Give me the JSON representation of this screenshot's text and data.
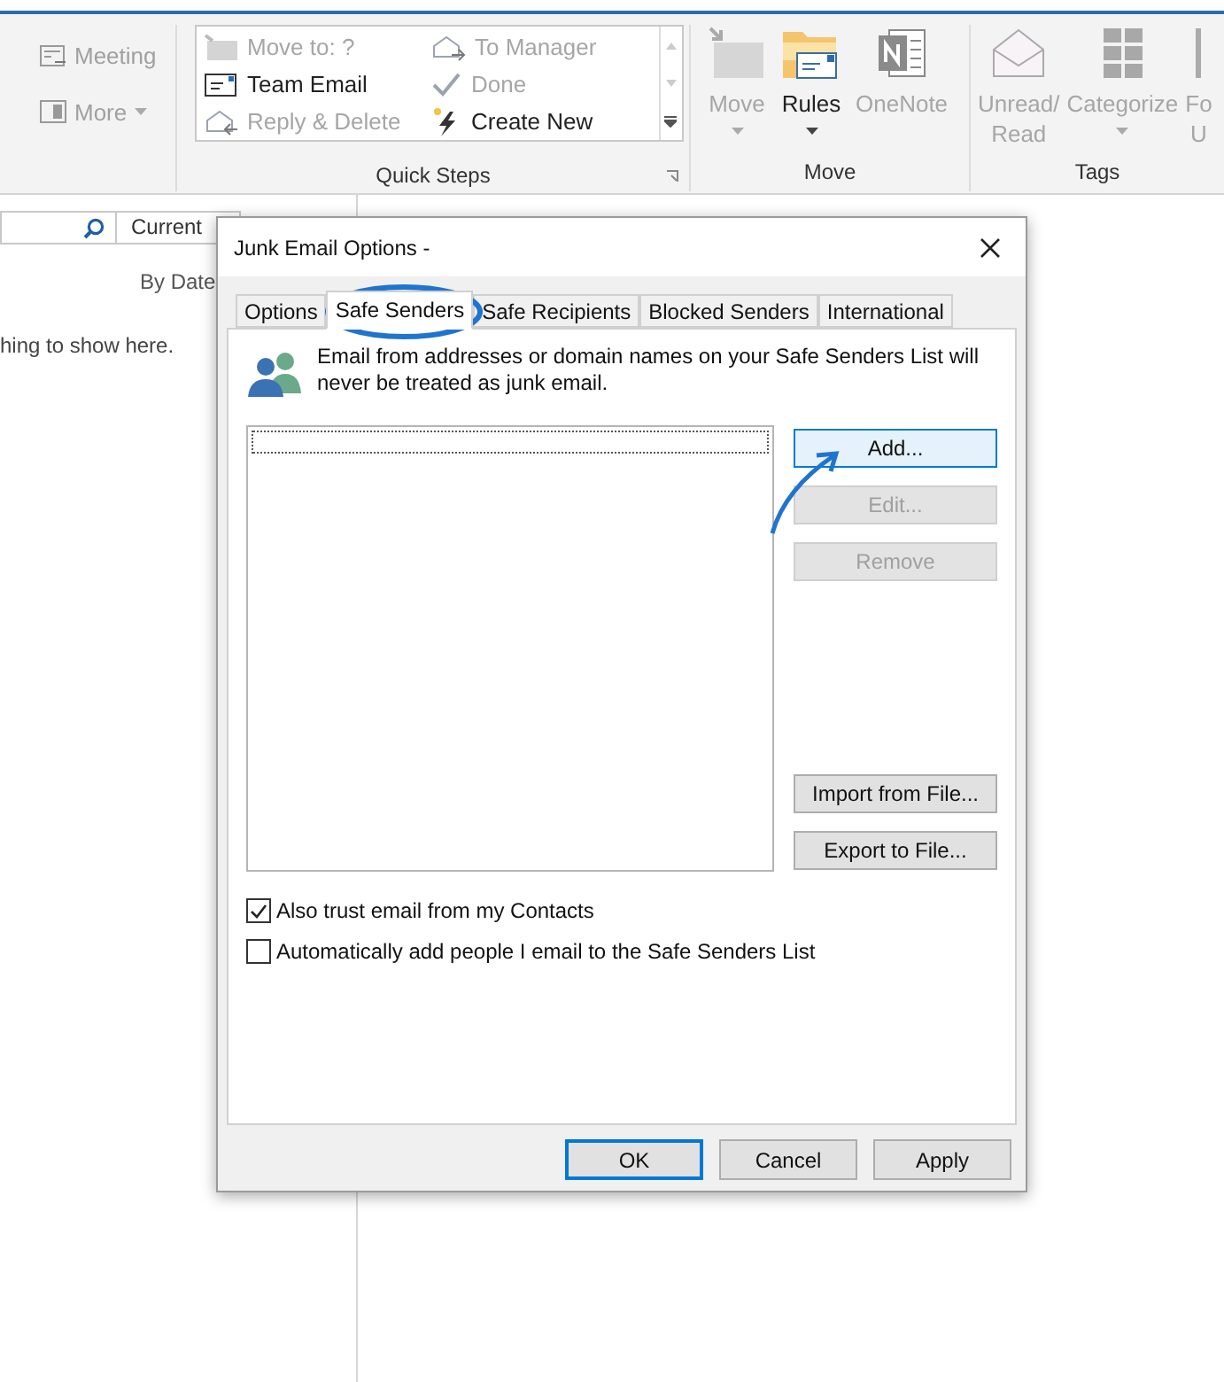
{
  "ribbon": {
    "left_items": [
      {
        "label": "Meeting",
        "disabled": true,
        "dropdown": false
      },
      {
        "label": "More",
        "disabled": true,
        "dropdown": true
      }
    ],
    "quick_steps": {
      "label": "Quick Steps",
      "items": [
        {
          "label": "Move to: ?",
          "disabled": true
        },
        {
          "label": "To Manager",
          "disabled": true
        },
        {
          "label": "Team Email",
          "disabled": false
        },
        {
          "label": "Done",
          "disabled": true
        },
        {
          "label": "Reply & Delete",
          "disabled": true
        },
        {
          "label": "Create New",
          "disabled": false
        }
      ]
    },
    "groups": [
      {
        "label": "Move",
        "buttons": [
          {
            "lines": [
              "Move"
            ],
            "disabled": true,
            "dropdown": true
          },
          {
            "lines": [
              "Rules"
            ],
            "disabled": false,
            "dropdown": true
          },
          {
            "lines": [
              "OneNote"
            ],
            "disabled": true,
            "dropdown": false
          }
        ]
      },
      {
        "label": "Tags",
        "buttons": [
          {
            "lines": [
              "Unread/",
              "Read"
            ],
            "disabled": true,
            "dropdown": false
          },
          {
            "lines": [
              "Categorize"
            ],
            "disabled": true,
            "dropdown": true
          },
          {
            "lines": [
              "Fo",
              "U"
            ],
            "disabled": true,
            "dropdown": false
          }
        ]
      }
    ]
  },
  "pane": {
    "filter": "Current",
    "sort": "By Date",
    "empty_message": "hing to show here."
  },
  "dialog": {
    "title": "Junk Email Options -",
    "tabs": [
      {
        "label": "Options",
        "selected": false
      },
      {
        "label": "Safe Senders",
        "selected": true
      },
      {
        "label": "Safe Recipients",
        "selected": false
      },
      {
        "label": "Blocked Senders",
        "selected": false
      },
      {
        "label": "International",
        "selected": false
      }
    ],
    "info": "Email from addresses or domain names on your Safe Senders List will never be treated as junk email.",
    "side_buttons": [
      {
        "label": "Add...",
        "disabled": false,
        "focused": true
      },
      {
        "label": "Edit...",
        "disabled": true,
        "focused": false
      },
      {
        "label": "Remove",
        "disabled": true,
        "focused": false
      }
    ],
    "file_buttons": [
      {
        "label": "Import from File...",
        "disabled": false,
        "focused": false
      },
      {
        "label": "Export to File...",
        "disabled": false,
        "focused": false
      }
    ],
    "checkboxes": [
      {
        "label": "Also trust email from my Contacts",
        "checked": true
      },
      {
        "label": "Automatically add people I email to the Safe Senders List",
        "checked": false
      }
    ],
    "footer_buttons": [
      {
        "label": "OK",
        "default": true
      },
      {
        "label": "Cancel",
        "default": false
      },
      {
        "label": "Apply",
        "default": false
      }
    ]
  }
}
